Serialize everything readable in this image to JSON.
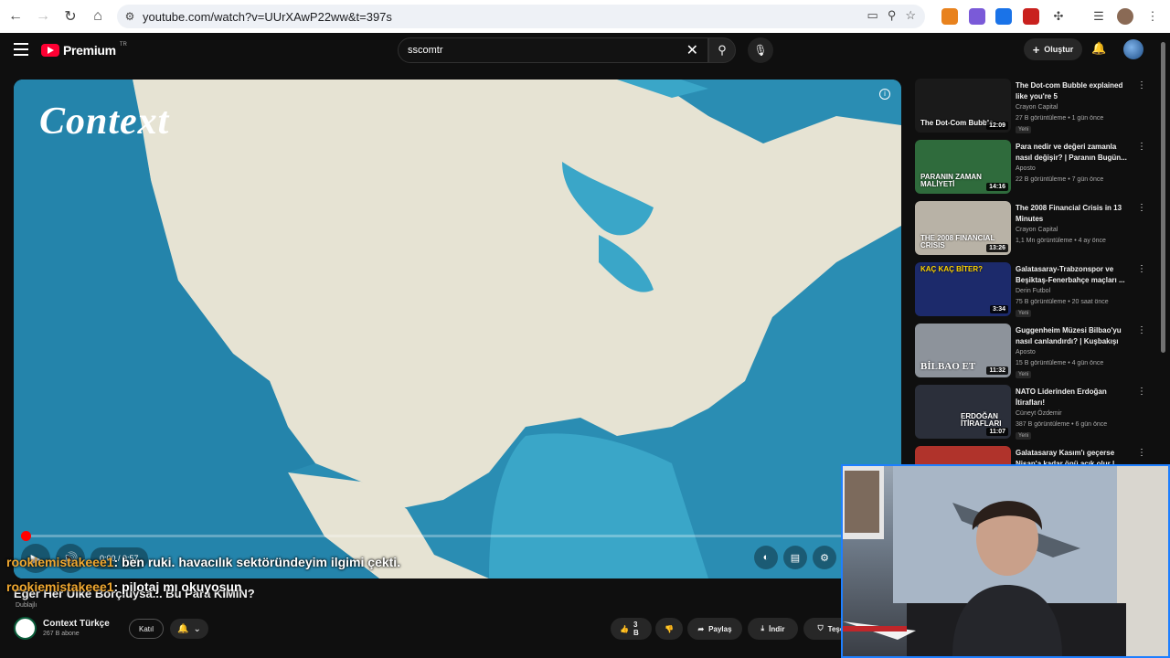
{
  "browser": {
    "url": "youtube.com/watch?v=UUrXAwP22ww&t=397s"
  },
  "header": {
    "brand": "Premium",
    "brand_country": "TR",
    "search_value": "sscomtr",
    "create_label": "Oluştur"
  },
  "player": {
    "overlay_title": "Context",
    "time": "0:00 / 9:57",
    "progress_fraction": 0.007
  },
  "chat": [
    {
      "user": "rookiemistakeee1",
      "message": ": ben ruki. havacılık sektöründeyim ilgimi çekti."
    },
    {
      "user": "rookiemistakeee1",
      "message": ": pilotaj mı okuyosun"
    }
  ],
  "video": {
    "title": "Eğer Her Ülke Borçluysa... Bu Para KİMİN?",
    "dubbed": "Dublajlı",
    "channel": "Context Türkçe",
    "subscribers": "267 B abone",
    "join_label": "Katıl",
    "likes": "3 B",
    "share_label": "Paylaş",
    "download_label": "İndir",
    "thanks_label": "Teşe"
  },
  "recommendations": [
    {
      "title": "The Dot-com Bubble explained like you're 5",
      "channel": "Crayon Capital",
      "meta": "27 B görüntüleme • 1 gün önce",
      "badge": "Yeni",
      "duration": "12:09",
      "thumb_text": "The Dot-Com Bubble",
      "thumb_color": "#1a1a1a"
    },
    {
      "title": "Para nedir ve değeri zamanla nasıl değişir? | Paranın Bugün...",
      "channel": "Aposto",
      "meta": "22 B görüntüleme • 7 gün önce",
      "badge": "",
      "duration": "14:16",
      "thumb_text": "PARANIN ZAMAN MALİYETİ",
      "thumb_color": "#2f6b3c"
    },
    {
      "title": "The 2008 Financial Crisis in 13 Minutes",
      "channel": "Crayon Capital",
      "meta": "1,1 Mn görüntüleme • 4 ay önce",
      "badge": "",
      "duration": "13:26",
      "thumb_text": "THE 2008 FINANCIAL CRISIS",
      "thumb_color": "#b8b2a6"
    },
    {
      "title": "Galatasaray-Trabzonspor ve Beşiktaş-Fenerbahçe maçları ...",
      "channel": "Derin Futbol",
      "meta": "75 B görüntüleme • 20 saat önce",
      "badge": "Yeni",
      "duration": "3:34",
      "thumb_text": "KAÇ KAÇ BİTER?",
      "thumb_color": "#1c2a6b"
    },
    {
      "title": "Guggenheim Müzesi Bilbao'yu nasıl canlandırdı? | Kuşbakışı",
      "channel": "Aposto",
      "meta": "15 B görüntüleme • 4 gün önce",
      "badge": "Yeni",
      "duration": "11:32",
      "thumb_text": "BİLBAO ET",
      "thumb_color": "#8d939b"
    },
    {
      "title": "NATO Liderinden Erdoğan İtirafları!",
      "channel": "Cüneyt Özdemir",
      "meta": "387 B görüntüleme • 6 gün önce",
      "badge": "Yeni",
      "duration": "11:07",
      "thumb_text": "ERDOĞAN İTİRAFLARI",
      "thumb_color": "#2b2f3a"
    },
    {
      "title": "Galatasaray Kasım'ı geçerse Nisan'a kadar önü açık olur | ...",
      "channel": "",
      "meta": "",
      "badge": "",
      "duration": "",
      "thumb_text": "",
      "thumb_color": "#b0332b"
    }
  ]
}
